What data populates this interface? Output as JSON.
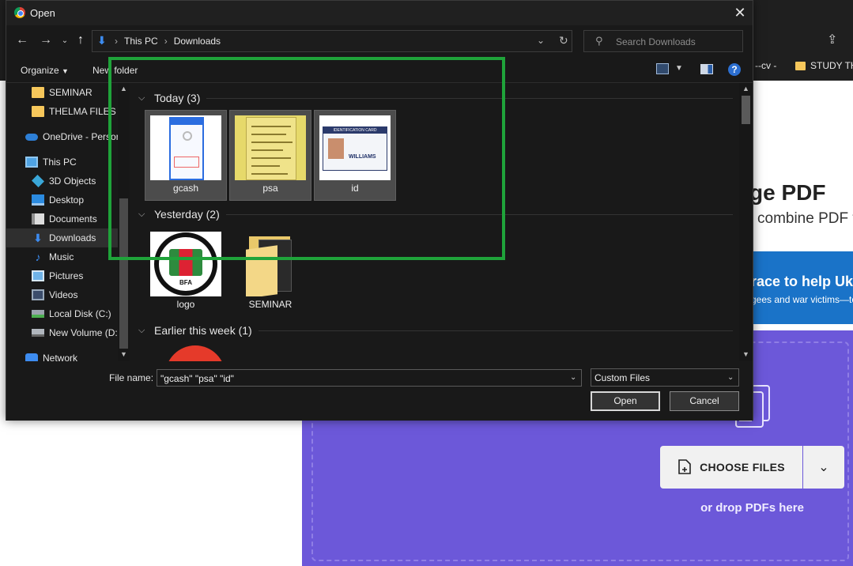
{
  "background": {
    "bookmarks": [
      "--cv -",
      "STUDY TH"
    ],
    "page_title": "ge PDF",
    "page_subtitle": "combine PDF f",
    "banner_title": "race to help Ukr",
    "banner_text": "gees and war victims—to",
    "choose_files_label": "CHOOSE FILES",
    "drop_text": "or drop PDFs here"
  },
  "dialog": {
    "title": "Open",
    "breadcrumb": [
      "This PC",
      "Downloads"
    ],
    "search_placeholder": "Search Downloads",
    "toolbar": {
      "organize": "Organize",
      "new_folder": "New folder",
      "help": "?"
    },
    "nav_items": [
      {
        "label": "SEMINAR",
        "icon": "folder-icon"
      },
      {
        "label": "THELMA FILES",
        "icon": "folder-icon"
      },
      {
        "label": "OneDrive - Person",
        "icon": "onedrive-icon"
      },
      {
        "label": "This PC",
        "icon": "computer-icon"
      },
      {
        "label": "3D Objects",
        "icon": "3d-objects-icon"
      },
      {
        "label": "Desktop",
        "icon": "desktop-icon"
      },
      {
        "label": "Documents",
        "icon": "documents-icon"
      },
      {
        "label": "Downloads",
        "icon": "downloads-icon",
        "selected": true
      },
      {
        "label": "Music",
        "icon": "music-icon"
      },
      {
        "label": "Pictures",
        "icon": "pictures-icon"
      },
      {
        "label": "Videos",
        "icon": "videos-icon"
      },
      {
        "label": "Local Disk (C:)",
        "icon": "local-disk-icon"
      },
      {
        "label": "New Volume (D:)",
        "icon": "drive-icon"
      },
      {
        "label": "Network",
        "icon": "network-icon"
      }
    ],
    "groups": [
      {
        "label": "Today (3)",
        "files": [
          {
            "name": "gcash",
            "selected": true
          },
          {
            "name": "psa",
            "selected": true
          },
          {
            "name": "id",
            "selected": true
          }
        ]
      },
      {
        "label": "Yesterday (2)",
        "files": [
          {
            "name": "logo"
          },
          {
            "name": "SEMINAR"
          }
        ]
      },
      {
        "label": "Earlier this week (1)",
        "files": []
      }
    ],
    "thumb_text": {
      "psa_stamp": "",
      "id_card_header": "IDENTIFICATION CARD",
      "id_card_name": "WILLIAMS",
      "logo_text": "BFA"
    },
    "footer": {
      "file_name_label": "File name:",
      "file_name_value": "\"gcash\" \"psa\" \"id\"",
      "file_type_value": "Custom Files",
      "open_label": "Open",
      "cancel_label": "Cancel"
    }
  },
  "colors": {
    "highlight": "#1fa33a",
    "accent": "#3d8cf0",
    "drop_zone": "#6c58d9"
  }
}
